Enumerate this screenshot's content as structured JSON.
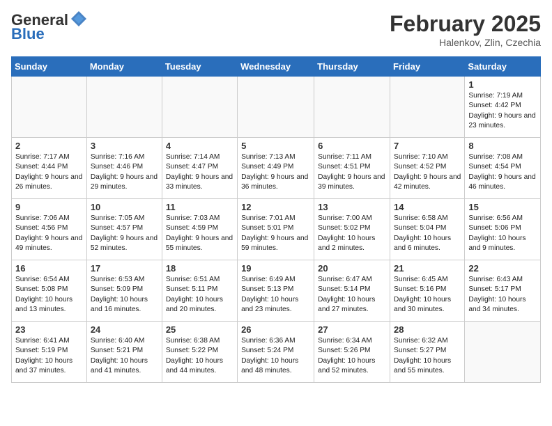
{
  "header": {
    "logo_general": "General",
    "logo_blue": "Blue",
    "month_year": "February 2025",
    "location": "Halenkov, Zlin, Czechia"
  },
  "days_of_week": [
    "Sunday",
    "Monday",
    "Tuesday",
    "Wednesday",
    "Thursday",
    "Friday",
    "Saturday"
  ],
  "weeks": [
    [
      {
        "day": "",
        "info": ""
      },
      {
        "day": "",
        "info": ""
      },
      {
        "day": "",
        "info": ""
      },
      {
        "day": "",
        "info": ""
      },
      {
        "day": "",
        "info": ""
      },
      {
        "day": "",
        "info": ""
      },
      {
        "day": "1",
        "info": "Sunrise: 7:19 AM\nSunset: 4:42 PM\nDaylight: 9 hours and 23 minutes."
      }
    ],
    [
      {
        "day": "2",
        "info": "Sunrise: 7:17 AM\nSunset: 4:44 PM\nDaylight: 9 hours and 26 minutes."
      },
      {
        "day": "3",
        "info": "Sunrise: 7:16 AM\nSunset: 4:46 PM\nDaylight: 9 hours and 29 minutes."
      },
      {
        "day": "4",
        "info": "Sunrise: 7:14 AM\nSunset: 4:47 PM\nDaylight: 9 hours and 33 minutes."
      },
      {
        "day": "5",
        "info": "Sunrise: 7:13 AM\nSunset: 4:49 PM\nDaylight: 9 hours and 36 minutes."
      },
      {
        "day": "6",
        "info": "Sunrise: 7:11 AM\nSunset: 4:51 PM\nDaylight: 9 hours and 39 minutes."
      },
      {
        "day": "7",
        "info": "Sunrise: 7:10 AM\nSunset: 4:52 PM\nDaylight: 9 hours and 42 minutes."
      },
      {
        "day": "8",
        "info": "Sunrise: 7:08 AM\nSunset: 4:54 PM\nDaylight: 9 hours and 46 minutes."
      }
    ],
    [
      {
        "day": "9",
        "info": "Sunrise: 7:06 AM\nSunset: 4:56 PM\nDaylight: 9 hours and 49 minutes."
      },
      {
        "day": "10",
        "info": "Sunrise: 7:05 AM\nSunset: 4:57 PM\nDaylight: 9 hours and 52 minutes."
      },
      {
        "day": "11",
        "info": "Sunrise: 7:03 AM\nSunset: 4:59 PM\nDaylight: 9 hours and 55 minutes."
      },
      {
        "day": "12",
        "info": "Sunrise: 7:01 AM\nSunset: 5:01 PM\nDaylight: 9 hours and 59 minutes."
      },
      {
        "day": "13",
        "info": "Sunrise: 7:00 AM\nSunset: 5:02 PM\nDaylight: 10 hours and 2 minutes."
      },
      {
        "day": "14",
        "info": "Sunrise: 6:58 AM\nSunset: 5:04 PM\nDaylight: 10 hours and 6 minutes."
      },
      {
        "day": "15",
        "info": "Sunrise: 6:56 AM\nSunset: 5:06 PM\nDaylight: 10 hours and 9 minutes."
      }
    ],
    [
      {
        "day": "16",
        "info": "Sunrise: 6:54 AM\nSunset: 5:08 PM\nDaylight: 10 hours and 13 minutes."
      },
      {
        "day": "17",
        "info": "Sunrise: 6:53 AM\nSunset: 5:09 PM\nDaylight: 10 hours and 16 minutes."
      },
      {
        "day": "18",
        "info": "Sunrise: 6:51 AM\nSunset: 5:11 PM\nDaylight: 10 hours and 20 minutes."
      },
      {
        "day": "19",
        "info": "Sunrise: 6:49 AM\nSunset: 5:13 PM\nDaylight: 10 hours and 23 minutes."
      },
      {
        "day": "20",
        "info": "Sunrise: 6:47 AM\nSunset: 5:14 PM\nDaylight: 10 hours and 27 minutes."
      },
      {
        "day": "21",
        "info": "Sunrise: 6:45 AM\nSunset: 5:16 PM\nDaylight: 10 hours and 30 minutes."
      },
      {
        "day": "22",
        "info": "Sunrise: 6:43 AM\nSunset: 5:17 PM\nDaylight: 10 hours and 34 minutes."
      }
    ],
    [
      {
        "day": "23",
        "info": "Sunrise: 6:41 AM\nSunset: 5:19 PM\nDaylight: 10 hours and 37 minutes."
      },
      {
        "day": "24",
        "info": "Sunrise: 6:40 AM\nSunset: 5:21 PM\nDaylight: 10 hours and 41 minutes."
      },
      {
        "day": "25",
        "info": "Sunrise: 6:38 AM\nSunset: 5:22 PM\nDaylight: 10 hours and 44 minutes."
      },
      {
        "day": "26",
        "info": "Sunrise: 6:36 AM\nSunset: 5:24 PM\nDaylight: 10 hours and 48 minutes."
      },
      {
        "day": "27",
        "info": "Sunrise: 6:34 AM\nSunset: 5:26 PM\nDaylight: 10 hours and 52 minutes."
      },
      {
        "day": "28",
        "info": "Sunrise: 6:32 AM\nSunset: 5:27 PM\nDaylight: 10 hours and 55 minutes."
      },
      {
        "day": "",
        "info": ""
      }
    ]
  ]
}
